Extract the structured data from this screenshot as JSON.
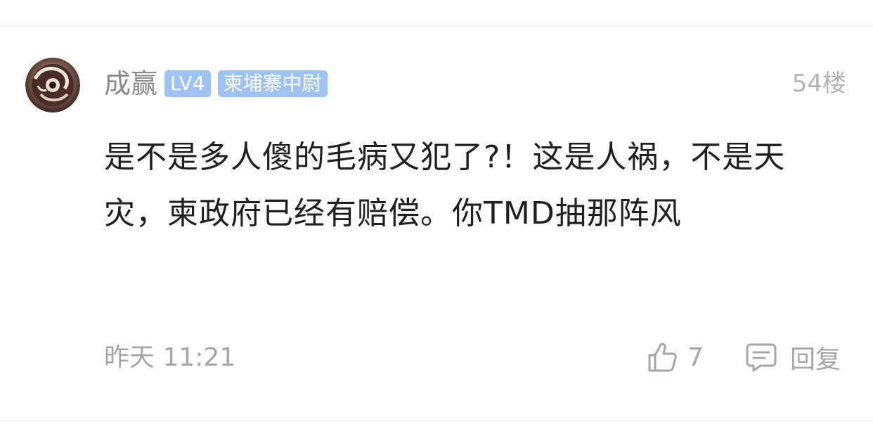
{
  "comment": {
    "author": {
      "name": "成赢",
      "level_badge": "LV4",
      "title_badge": "柬埔寨中尉",
      "avatar": "ornament-avatar-icon"
    },
    "floor": "54楼",
    "text": "是不是多人傻的毛病又犯了?！这是人祸，不是天灾，柬政府已经有赔偿。你TMD抽那阵风",
    "timestamp": "昨天 11:21",
    "likes": "7",
    "reply_label": "回复",
    "icons": {
      "like": "thumbs-up-icon",
      "reply": "comment-bubble-icon"
    }
  },
  "colors": {
    "badge": "#9ec2f2",
    "muted": "#a6a6a6",
    "text": "#1f1f1f"
  }
}
